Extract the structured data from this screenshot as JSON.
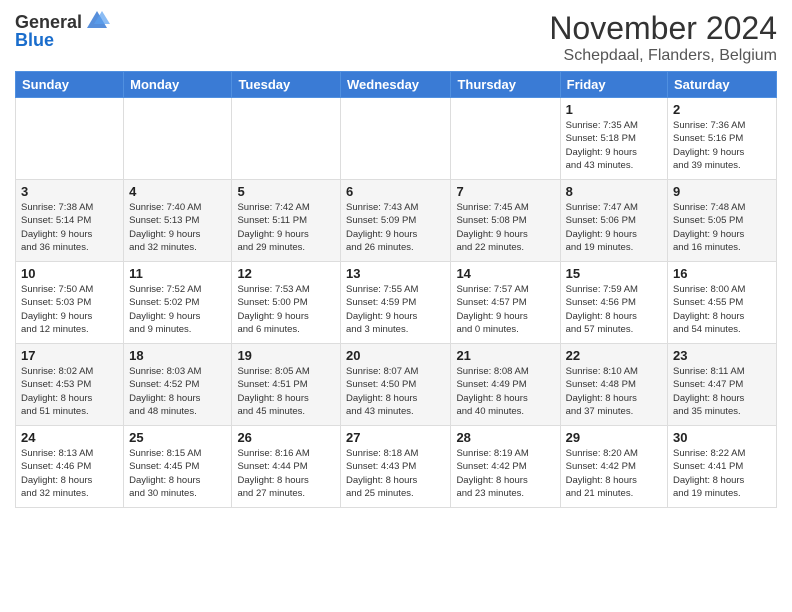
{
  "header": {
    "logo_general": "General",
    "logo_blue": "Blue",
    "month_title": "November 2024",
    "location": "Schepdaal, Flanders, Belgium"
  },
  "days_of_week": [
    "Sunday",
    "Monday",
    "Tuesday",
    "Wednesday",
    "Thursday",
    "Friday",
    "Saturday"
  ],
  "weeks": [
    {
      "days": [
        {
          "num": "",
          "info": ""
        },
        {
          "num": "",
          "info": ""
        },
        {
          "num": "",
          "info": ""
        },
        {
          "num": "",
          "info": ""
        },
        {
          "num": "",
          "info": ""
        },
        {
          "num": "1",
          "info": "Sunrise: 7:35 AM\nSunset: 5:18 PM\nDaylight: 9 hours\nand 43 minutes."
        },
        {
          "num": "2",
          "info": "Sunrise: 7:36 AM\nSunset: 5:16 PM\nDaylight: 9 hours\nand 39 minutes."
        }
      ]
    },
    {
      "days": [
        {
          "num": "3",
          "info": "Sunrise: 7:38 AM\nSunset: 5:14 PM\nDaylight: 9 hours\nand 36 minutes."
        },
        {
          "num": "4",
          "info": "Sunrise: 7:40 AM\nSunset: 5:13 PM\nDaylight: 9 hours\nand 32 minutes."
        },
        {
          "num": "5",
          "info": "Sunrise: 7:42 AM\nSunset: 5:11 PM\nDaylight: 9 hours\nand 29 minutes."
        },
        {
          "num": "6",
          "info": "Sunrise: 7:43 AM\nSunset: 5:09 PM\nDaylight: 9 hours\nand 26 minutes."
        },
        {
          "num": "7",
          "info": "Sunrise: 7:45 AM\nSunset: 5:08 PM\nDaylight: 9 hours\nand 22 minutes."
        },
        {
          "num": "8",
          "info": "Sunrise: 7:47 AM\nSunset: 5:06 PM\nDaylight: 9 hours\nand 19 minutes."
        },
        {
          "num": "9",
          "info": "Sunrise: 7:48 AM\nSunset: 5:05 PM\nDaylight: 9 hours\nand 16 minutes."
        }
      ]
    },
    {
      "days": [
        {
          "num": "10",
          "info": "Sunrise: 7:50 AM\nSunset: 5:03 PM\nDaylight: 9 hours\nand 12 minutes."
        },
        {
          "num": "11",
          "info": "Sunrise: 7:52 AM\nSunset: 5:02 PM\nDaylight: 9 hours\nand 9 minutes."
        },
        {
          "num": "12",
          "info": "Sunrise: 7:53 AM\nSunset: 5:00 PM\nDaylight: 9 hours\nand 6 minutes."
        },
        {
          "num": "13",
          "info": "Sunrise: 7:55 AM\nSunset: 4:59 PM\nDaylight: 9 hours\nand 3 minutes."
        },
        {
          "num": "14",
          "info": "Sunrise: 7:57 AM\nSunset: 4:57 PM\nDaylight: 9 hours\nand 0 minutes."
        },
        {
          "num": "15",
          "info": "Sunrise: 7:59 AM\nSunset: 4:56 PM\nDaylight: 8 hours\nand 57 minutes."
        },
        {
          "num": "16",
          "info": "Sunrise: 8:00 AM\nSunset: 4:55 PM\nDaylight: 8 hours\nand 54 minutes."
        }
      ]
    },
    {
      "days": [
        {
          "num": "17",
          "info": "Sunrise: 8:02 AM\nSunset: 4:53 PM\nDaylight: 8 hours\nand 51 minutes."
        },
        {
          "num": "18",
          "info": "Sunrise: 8:03 AM\nSunset: 4:52 PM\nDaylight: 8 hours\nand 48 minutes."
        },
        {
          "num": "19",
          "info": "Sunrise: 8:05 AM\nSunset: 4:51 PM\nDaylight: 8 hours\nand 45 minutes."
        },
        {
          "num": "20",
          "info": "Sunrise: 8:07 AM\nSunset: 4:50 PM\nDaylight: 8 hours\nand 43 minutes."
        },
        {
          "num": "21",
          "info": "Sunrise: 8:08 AM\nSunset: 4:49 PM\nDaylight: 8 hours\nand 40 minutes."
        },
        {
          "num": "22",
          "info": "Sunrise: 8:10 AM\nSunset: 4:48 PM\nDaylight: 8 hours\nand 37 minutes."
        },
        {
          "num": "23",
          "info": "Sunrise: 8:11 AM\nSunset: 4:47 PM\nDaylight: 8 hours\nand 35 minutes."
        }
      ]
    },
    {
      "days": [
        {
          "num": "24",
          "info": "Sunrise: 8:13 AM\nSunset: 4:46 PM\nDaylight: 8 hours\nand 32 minutes."
        },
        {
          "num": "25",
          "info": "Sunrise: 8:15 AM\nSunset: 4:45 PM\nDaylight: 8 hours\nand 30 minutes."
        },
        {
          "num": "26",
          "info": "Sunrise: 8:16 AM\nSunset: 4:44 PM\nDaylight: 8 hours\nand 27 minutes."
        },
        {
          "num": "27",
          "info": "Sunrise: 8:18 AM\nSunset: 4:43 PM\nDaylight: 8 hours\nand 25 minutes."
        },
        {
          "num": "28",
          "info": "Sunrise: 8:19 AM\nSunset: 4:42 PM\nDaylight: 8 hours\nand 23 minutes."
        },
        {
          "num": "29",
          "info": "Sunrise: 8:20 AM\nSunset: 4:42 PM\nDaylight: 8 hours\nand 21 minutes."
        },
        {
          "num": "30",
          "info": "Sunrise: 8:22 AM\nSunset: 4:41 PM\nDaylight: 8 hours\nand 19 minutes."
        }
      ]
    }
  ]
}
